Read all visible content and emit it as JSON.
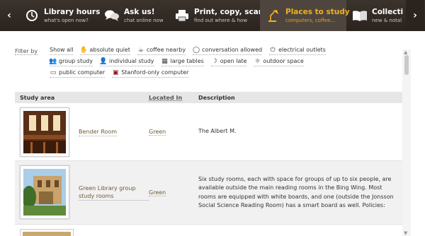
{
  "nav": {
    "prev_arrow": "‹",
    "next_arrow": "›",
    "items": [
      {
        "title": "Library hours",
        "subtitle": "what's open now?",
        "icon": "clock-icon",
        "active": false
      },
      {
        "title": "Ask us!",
        "subtitle": "chat online now",
        "icon": "chat-bubbles-icon",
        "active": false
      },
      {
        "title": "Print, copy, scan",
        "subtitle": "find out where & how",
        "icon": "printer-icon",
        "active": false
      },
      {
        "title": "Places to study",
        "subtitle": "computers, coffee...",
        "icon": "desk-lamp-icon",
        "active": true
      },
      {
        "title": "Collecti",
        "subtitle": "new & notal",
        "icon": "book-icon",
        "active": false
      }
    ]
  },
  "filters": {
    "label": "Filter by",
    "items": [
      {
        "label": "Show all",
        "icon": ""
      },
      {
        "label": "absolute quiet",
        "icon": "quiet-icon"
      },
      {
        "label": "coffee nearby",
        "icon": "coffee-cup-icon"
      },
      {
        "label": "conversation allowed",
        "icon": "speech-bubble-icon"
      },
      {
        "label": "electrical outlets",
        "icon": "outlet-icon"
      },
      {
        "label": "group study",
        "icon": "group-icon"
      },
      {
        "label": "individual study",
        "icon": "person-icon"
      },
      {
        "label": "large tables",
        "icon": "table-icon"
      },
      {
        "label": "open late",
        "icon": "moon-icon"
      },
      {
        "label": "outdoor space",
        "icon": "sun-icon"
      },
      {
        "label": "public computer",
        "icon": "computer-icon"
      },
      {
        "label": "Stanford-only computer",
        "icon": "stanford-computer-icon"
      }
    ]
  },
  "table": {
    "headers": {
      "area": "Study area",
      "location": "Located In",
      "description": "Description"
    },
    "rows": [
      {
        "name": "Bender Room",
        "location": "Green",
        "description": "The Albert M."
      },
      {
        "name": "Green Library group study rooms",
        "location": "Green",
        "description": "Six study rooms, each with space for groups of up to six people, are available outside the main reading rooms in the Bing Wing. Most rooms are equipped with white boards, and one (outside the Jonsson Social Science Reading Room) has a smart board as well. Policies:"
      }
    ]
  },
  "colors": {
    "nav_bg": "#2f2822",
    "active_title": "#f0b020",
    "link": "#6b5a3a"
  }
}
